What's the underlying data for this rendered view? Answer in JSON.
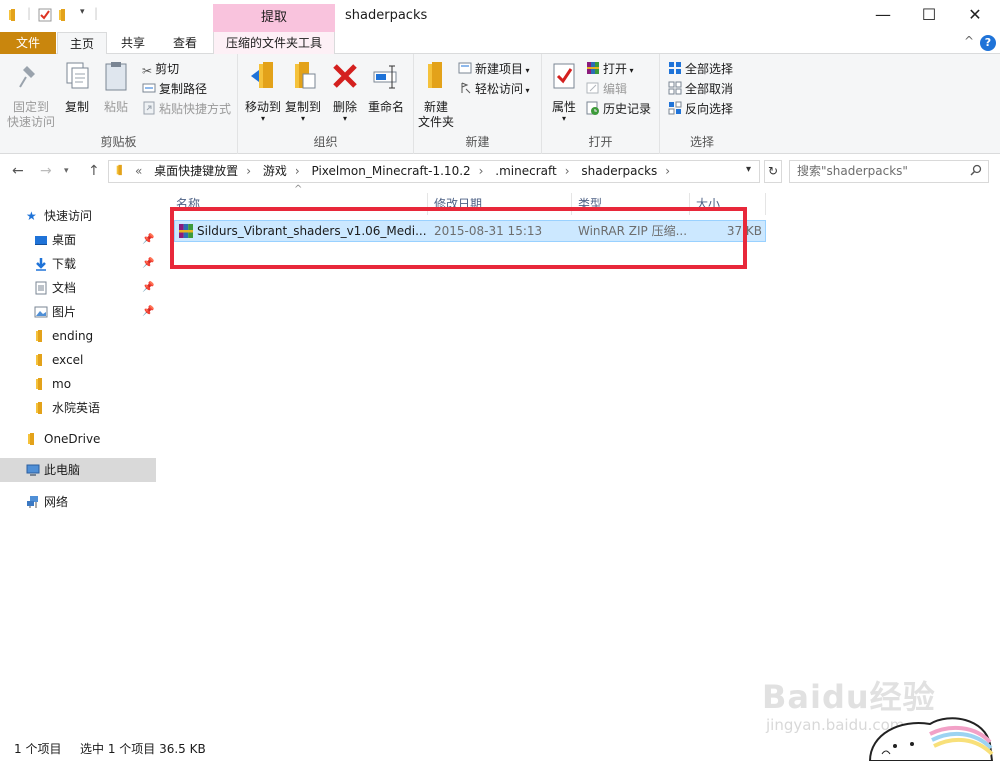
{
  "window": {
    "title": "shaderpacks",
    "context_tab_head": "提取",
    "minimize_glyph": "—",
    "maximize_glyph": "☐",
    "close_glyph": "✕"
  },
  "ribbon_tabs": {
    "file": "文件",
    "home": "主页",
    "share": "共享",
    "view": "查看",
    "tools": "压缩的文件夹工具",
    "help": "?",
    "collapse": "^"
  },
  "ribbon": {
    "clipboard": {
      "label": "剪贴板",
      "pin_line1": "固定到",
      "pin_line2": "快速访问",
      "copy": "复制",
      "paste": "粘贴",
      "cut": "剪切",
      "copy_path": "复制路径",
      "paste_shortcut": "粘贴快捷方式"
    },
    "organize": {
      "label": "组织",
      "move_to": "移动到",
      "copy_to": "复制到",
      "delete": "删除",
      "rename": "重命名"
    },
    "new": {
      "label": "新建",
      "new_folder_line1": "新建",
      "new_folder_line2": "文件夹",
      "new_item": "新建项目",
      "easy_access": "轻松访问"
    },
    "open": {
      "label": "打开",
      "properties": "属性",
      "open": "打开",
      "edit": "编辑",
      "history": "历史记录"
    },
    "select": {
      "label": "选择",
      "select_all": "全部选择",
      "select_none": "全部取消",
      "invert": "反向选择"
    }
  },
  "navigation": {
    "back": "←",
    "forward": "→",
    "up": "↑",
    "overflow": "«",
    "breadcrumb": [
      "桌面快捷键放置",
      "游戏",
      "Pixelmon_Minecraft-1.10.2",
      ".minecraft",
      "shaderpacks"
    ],
    "refresh_glyph": "↻",
    "search_placeholder": "搜索\"shaderpacks\""
  },
  "nav_pane": {
    "quick_access": "快速访问",
    "items": [
      "桌面",
      "下载",
      "文档",
      "图片",
      "ending",
      "excel",
      "mo",
      "水院英语"
    ],
    "onedrive": "OneDrive",
    "this_pc": "此电脑",
    "network": "网络",
    "pin_glyph": "📌"
  },
  "file_list": {
    "sort_glyph": "^",
    "columns": [
      "名称",
      "修改日期",
      "类型",
      "大小"
    ],
    "rows": [
      {
        "name": "Sildurs_Vibrant_shaders_v1.06_Medi...",
        "modified": "2015-08-31 15:13",
        "type": "WinRAR ZIP 压缩...",
        "size": "37 KB"
      }
    ]
  },
  "status": {
    "count": "1 个项目",
    "selected": "选中 1 个项目  36.5 KB"
  },
  "watermark": {
    "brand": "Baidu经验",
    "url": "jingyan.baidu.com"
  },
  "colors": {
    "file_tab": "#c9860d",
    "context_tab": "#f9c3dd",
    "selection": "#cce8ff",
    "highlight_box": "#e8283a",
    "folder": "#f5c23b"
  }
}
